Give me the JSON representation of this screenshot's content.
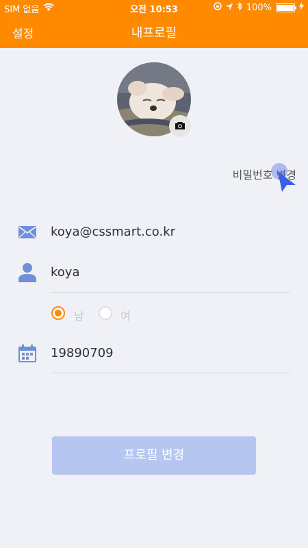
{
  "status_bar": {
    "carrier": "SIM 없음",
    "time": "오전 10:53",
    "battery": "100%",
    "battery_level": 1.0
  },
  "nav": {
    "left_label": "설정",
    "title": "내프로필"
  },
  "profile": {
    "change_password": "비밀번호 변경",
    "email": "koya@cssmart.co.kr",
    "name": "koya",
    "gender": {
      "options": [
        "남",
        "여"
      ],
      "selected": "남"
    },
    "birthdate": "19890709"
  },
  "submit_label": "프로필 변경",
  "colors": {
    "accent": "#ff8a00",
    "icon_blue": "#6f8fd9",
    "button_disabled": "#b5c6f1",
    "background": "#f0f0f7"
  }
}
